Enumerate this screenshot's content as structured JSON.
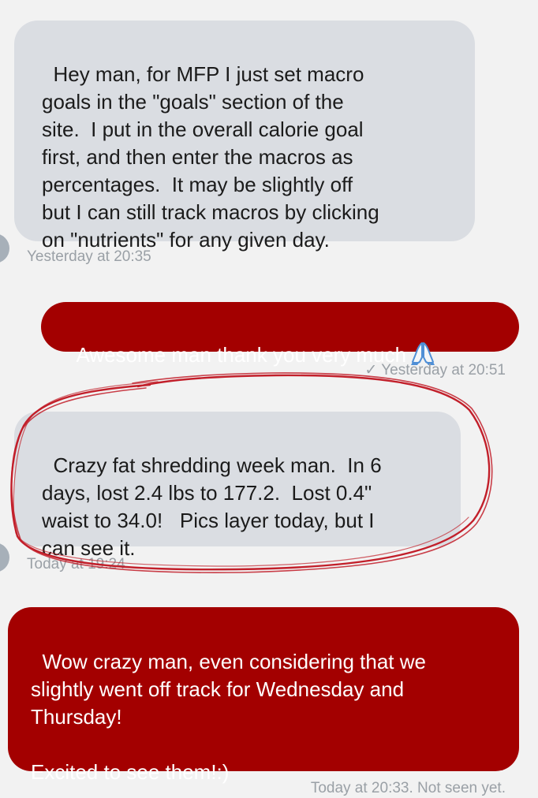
{
  "messages": [
    {
      "direction": "incoming",
      "text": "Hey man, for MFP I just set macro\ngoals in the \"goals\" section of the\nsite.  I put in the overall calorie goal\nfirst, and then enter the macros as\npercentages.  It may be slightly off\nbut I can still track macros by clicking\non \"nutrients\" for any given day.",
      "timestamp": "Yesterday at 20:35"
    },
    {
      "direction": "outgoing",
      "text": "Awesome man thank you very much",
      "emoji": "folded-hands-icon",
      "timestamp": "✓ Yesterday at 20:51"
    },
    {
      "direction": "incoming",
      "text": "Crazy fat shredding week man.  In 6\ndays, lost 2.4 lbs to 177.2.  Lost 0.4\"\nwaist to 34.0!   Pics layer today, but I\ncan see it.",
      "timestamp": "Today at 19:24",
      "highlighted": true
    },
    {
      "direction": "outgoing",
      "text": "Wow crazy man, even considering that we\nslightly went off track for Wednesday and\nThursday!\n\nExcited to see them!:)",
      "timestamp": "Today at 20:33. Not seen yet."
    }
  ],
  "colors": {
    "background": "#f2f2f2",
    "incoming_bubble": "#dadde2",
    "outgoing_bubble": "#a30000",
    "timestamp_text": "#9aa0a6",
    "annotation_stroke": "#c21f2a"
  }
}
